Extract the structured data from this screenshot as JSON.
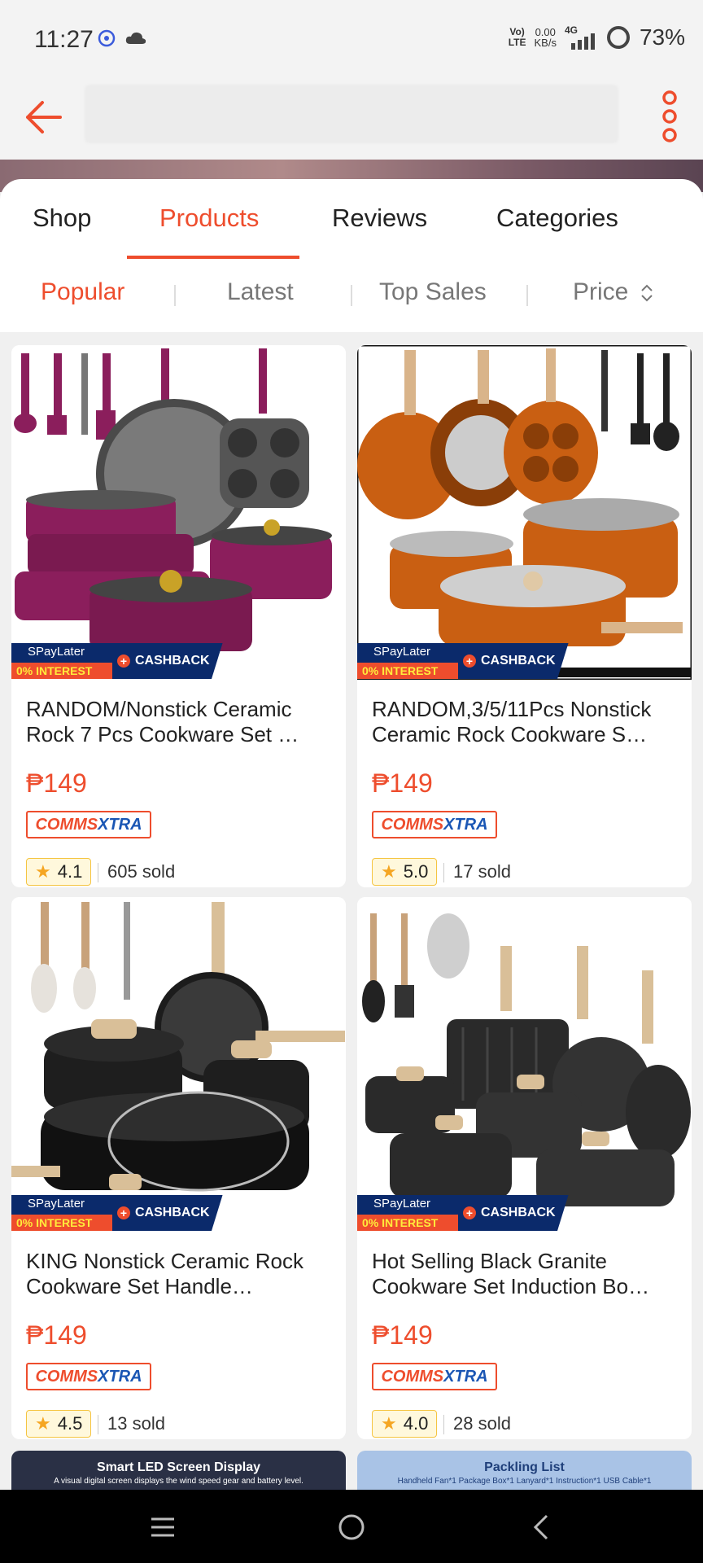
{
  "status_bar": {
    "time": "11:27",
    "volte_top": "Vo)",
    "volte_bottom": "LTE",
    "speed_top": "0.00",
    "speed_bottom": "KB/s",
    "network": "4G",
    "battery": "73%"
  },
  "header": {
    "back_icon": "back-arrow-icon",
    "more_icon": "more-vert-icon"
  },
  "tabs": [
    {
      "label": "Shop",
      "active": false
    },
    {
      "label": "Products",
      "active": true
    },
    {
      "label": "Reviews",
      "active": false
    },
    {
      "label": "Categories",
      "active": false
    }
  ],
  "sort": [
    {
      "label": "Popular",
      "active": true
    },
    {
      "label": "Latest",
      "active": false
    },
    {
      "label": "Top Sales",
      "active": false
    },
    {
      "label": "Price",
      "active": false
    }
  ],
  "promo": {
    "top": "SPayLater",
    "bottom": "0% INTEREST",
    "right": "CASHBACK"
  },
  "badge": {
    "part1": "COMMS",
    "part2": "XTRA"
  },
  "products": [
    {
      "title": "RANDOM/Nonstick Ceramic Rock 7 Pcs Cookware Set …",
      "price": "₱149",
      "rating": "4.1",
      "sold": "605 sold",
      "image": "purple cookware set"
    },
    {
      "title": "RANDOM,3/5/11Pcs Nonstick Ceramic Rock Cookware S…",
      "price": "₱149",
      "rating": "5.0",
      "sold": "17 sold",
      "image": "orange cookware set"
    },
    {
      "title": "KING Nonstick Ceramic Rock Cookware Set Handle…",
      "price": "₱149",
      "rating": "4.5",
      "sold": "13 sold",
      "image": "black granite cookware set"
    },
    {
      "title": "Hot Selling Black Granite Cookware Set Induction Bo…",
      "price": "₱149",
      "rating": "4.0",
      "sold": "28 sold",
      "image": "black granite cookware set with grill pan"
    }
  ],
  "peek": [
    {
      "title": "Smart LED Screen Display",
      "sub": "A visual digital screen displays the wind speed gear and battery level."
    },
    {
      "title": "Packling List",
      "sub": "Handheld Fan*1  Package Box*1  Lanyard*1  Instruction*1  USB Cable*1"
    }
  ],
  "colors": {
    "accent": "#ee4d2d",
    "badge_blue": "#1a56b4",
    "promo_navy": "#0b2a6b"
  }
}
